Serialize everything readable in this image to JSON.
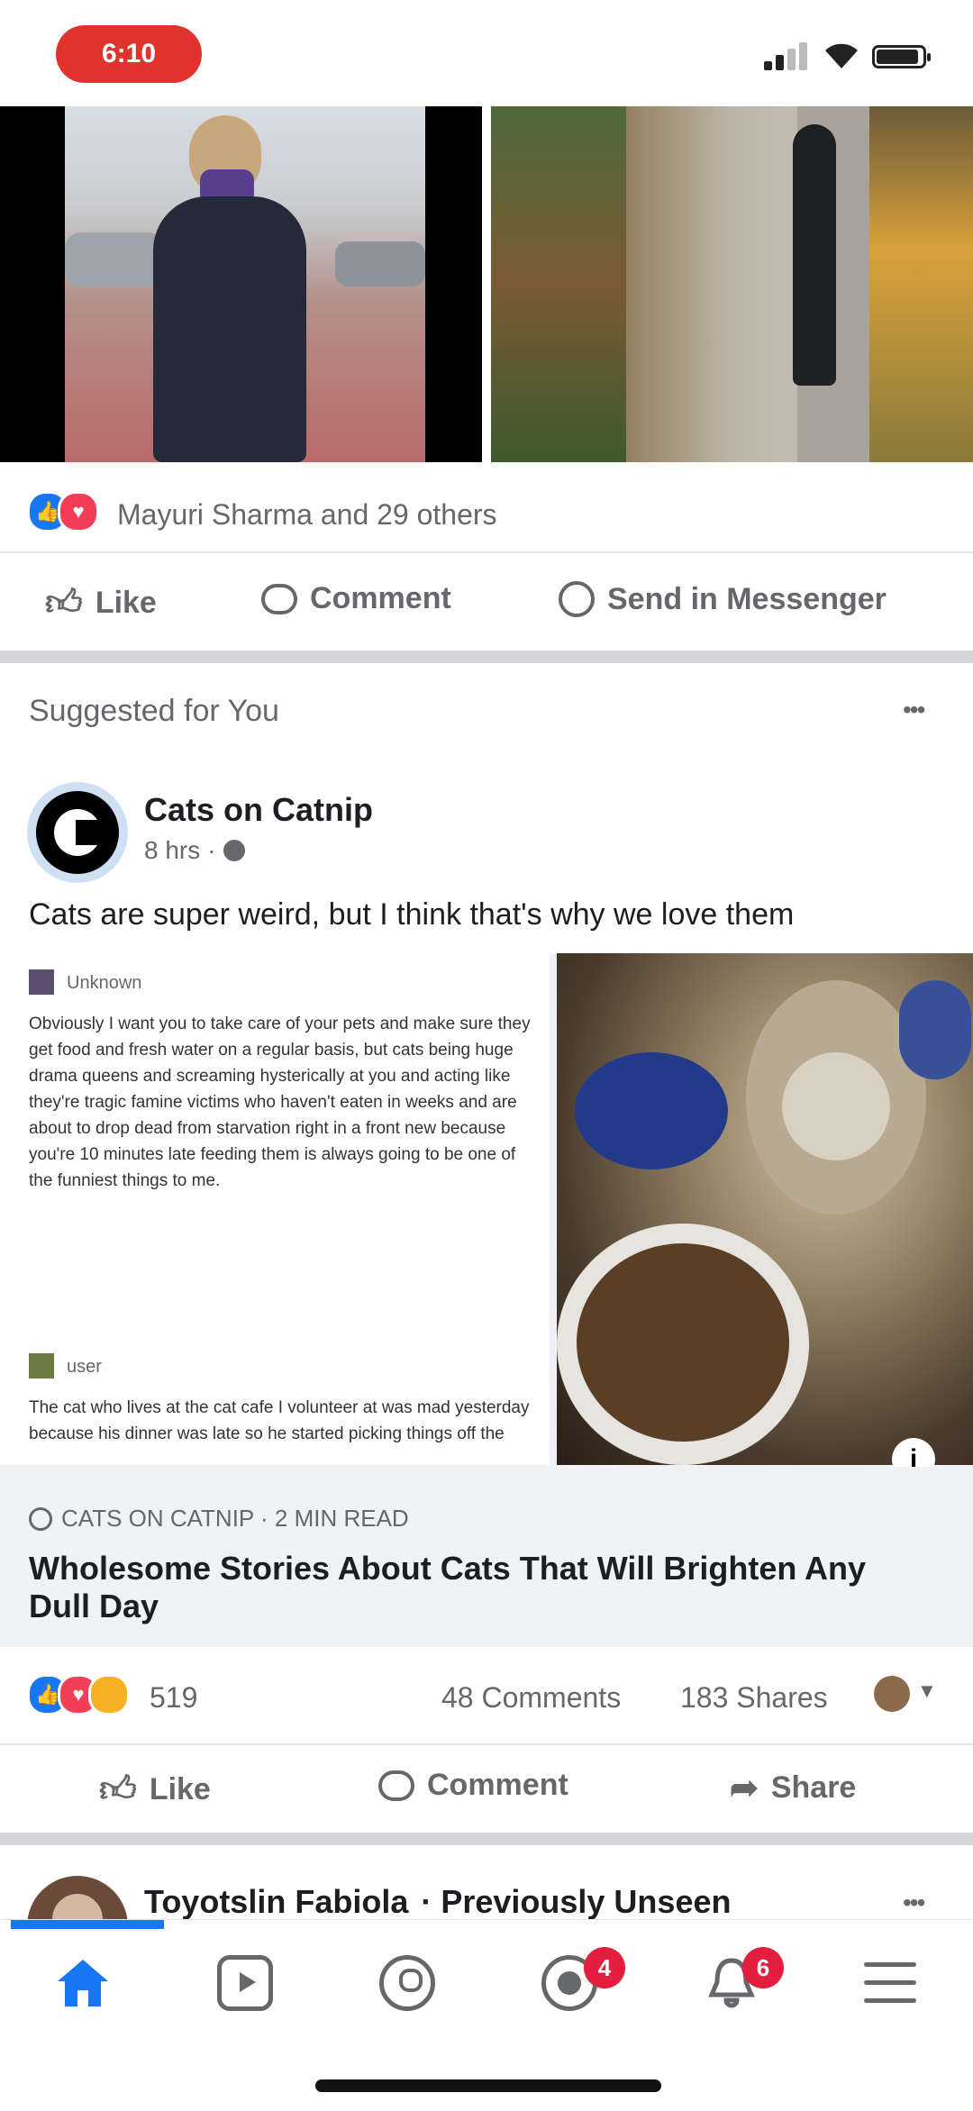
{
  "status_bar": {
    "time": "6:10"
  },
  "post1": {
    "reaction_summary": "Mayuri Sharma and 29 others",
    "actions": {
      "like": "Like",
      "comment": "Comment",
      "send": "Send in Messenger"
    }
  },
  "suggested": {
    "header": "Suggested for You",
    "more": "•••",
    "page_name": "Cats on Catnip",
    "time": "8 hrs",
    "post_text": "Cats are super weird, but I think that's why we love them",
    "article": {
      "user1": "Unknown",
      "paragraph1": "Obviously I want you to take care of your pets and make sure they get food and fresh water on a regular basis, but cats being huge drama queens and screaming hysterically at you and acting like they're tragic famine victims who haven't eaten in weeks and are about to drop dead from starvation right in a front new because you're 10 minutes late feeding them is always going to be one of the funniest things to me.",
      "user2": "user",
      "paragraph2": "The cat who lives at the cat cafe I volunteer at was mad yesterday because his dinner was late so he started picking things off the",
      "source": "CATS ON CATNIP · 2 MIN READ",
      "title": "Wholesome Stories About Cats That Will Brighten Any Dull Day"
    },
    "stats": {
      "reactions": "519",
      "comments": "48 Comments",
      "shares": "183 Shares"
    },
    "actions": {
      "like": "Like",
      "comment": "Comment",
      "share": "Share"
    }
  },
  "next_post": {
    "author": "Toyotslin Fabiola",
    "meta": "· Previously Unseen",
    "more": "•••"
  },
  "nav": {
    "notifications_badge": "4",
    "activity_badge": "6"
  },
  "colors": {
    "brand_blue": "#1877f2",
    "badge_red": "#e41e3f",
    "time_pill": "#e0332e"
  }
}
